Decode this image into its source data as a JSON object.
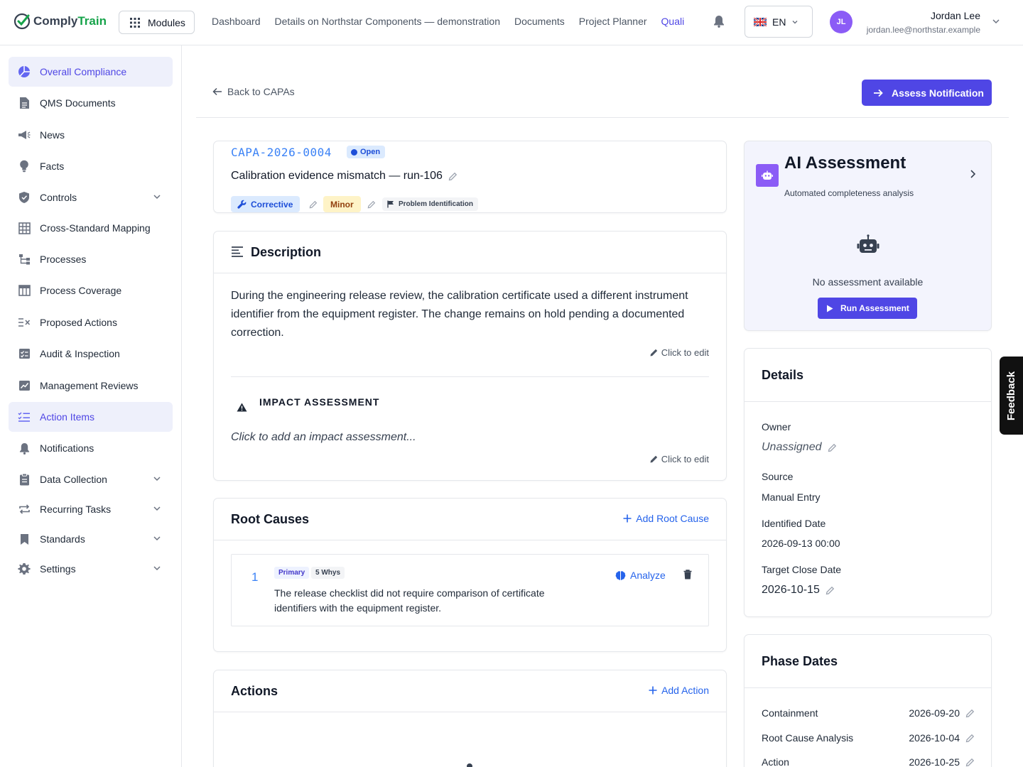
{
  "brand": {
    "name_part1": "Comply",
    "name_part2": "Train"
  },
  "header": {
    "modules_label": "Modules",
    "nav": [
      "Dashboard",
      "Details on Northstar Components — demonstration",
      "Documents",
      "Project Planner",
      "Quali"
    ],
    "language": "EN",
    "user": {
      "initials": "JL",
      "name": "Jordan Lee",
      "email": "jordan.lee@northstar.example"
    }
  },
  "sidebar": {
    "items": [
      {
        "label": "Overall Compliance",
        "icon": "pie-chart-icon",
        "active": true
      },
      {
        "label": "QMS Documents",
        "icon": "document-icon"
      },
      {
        "label": "News",
        "icon": "megaphone-icon"
      },
      {
        "label": "Facts",
        "icon": "lightbulb-icon"
      },
      {
        "label": "Controls",
        "icon": "shield-icon",
        "expandable": true
      },
      {
        "label": "Cross-Standard Mapping",
        "icon": "grid-icon"
      },
      {
        "label": "Processes",
        "icon": "process-icon"
      },
      {
        "label": "Process Coverage",
        "icon": "table-icon"
      },
      {
        "label": "Proposed Actions",
        "icon": "list-check-icon"
      },
      {
        "label": "Audit & Inspection",
        "icon": "checklist-icon"
      },
      {
        "label": "Management Reviews",
        "icon": "chart-icon"
      },
      {
        "label": "Action Items",
        "icon": "tasks-icon",
        "active": true
      },
      {
        "label": "Notifications",
        "icon": "bell-icon"
      },
      {
        "label": "Data Collection",
        "icon": "clipboard-icon",
        "expandable": true
      },
      {
        "label": "Recurring Tasks",
        "icon": "repeat-icon",
        "expandable": true
      },
      {
        "label": "Standards",
        "icon": "bookmark-icon",
        "expandable": true
      },
      {
        "label": "Settings",
        "icon": "gear-icon",
        "expandable": true
      }
    ]
  },
  "page": {
    "back_label": "Back to CAPAs",
    "assess_label": "Assess Notification"
  },
  "capa": {
    "id": "CAPA-2026-0004",
    "status": "Open",
    "title": "Calibration evidence mismatch — run-106",
    "type": "Corrective",
    "severity": "Minor",
    "phase": "Problem Identification"
  },
  "description": {
    "title": "Description",
    "text": "During the engineering release review, the calibration certificate used a different instrument identifier from the equipment register. The change remains on hold pending a documented correction.",
    "edit_label": "Click to edit",
    "impact_title": "IMPACT ASSESSMENT",
    "impact_placeholder": "Click to add an impact assessment...",
    "impact_edit_label": "Click to edit"
  },
  "root_causes": {
    "title": "Root Causes",
    "add_label": "Add Root Cause",
    "items": [
      {
        "number": "1",
        "tag_primary": "Primary",
        "tag_method": "5 Whys",
        "text": "The release checklist did not require comparison of certificate identifiers with the equipment register.",
        "analyze_label": "Analyze"
      }
    ]
  },
  "actions": {
    "title": "Actions",
    "add_label": "Add Action"
  },
  "ai": {
    "title": "AI Assessment",
    "subtitle": "Automated completeness analysis",
    "empty_text": "No assessment available",
    "run_label": "Run Assessment"
  },
  "details": {
    "title": "Details",
    "owner_label": "Owner",
    "owner_value": "Unassigned",
    "source_label": "Source",
    "source_value": "Manual Entry",
    "identified_label": "Identified Date",
    "identified_value": "2026-09-13 00:00",
    "target_label": "Target Close Date",
    "target_value": "2026-10-15"
  },
  "phase_dates": {
    "title": "Phase Dates",
    "rows": [
      {
        "label": "Containment",
        "date": "2026-09-20"
      },
      {
        "label": "Root Cause Analysis",
        "date": "2026-10-04"
      },
      {
        "label": "Action",
        "date": "2026-10-25"
      }
    ]
  },
  "feedback_label": "Feedback",
  "colors": {
    "accent": "#4f46e5",
    "link": "#2563eb",
    "brand_green": "#16a34a"
  }
}
